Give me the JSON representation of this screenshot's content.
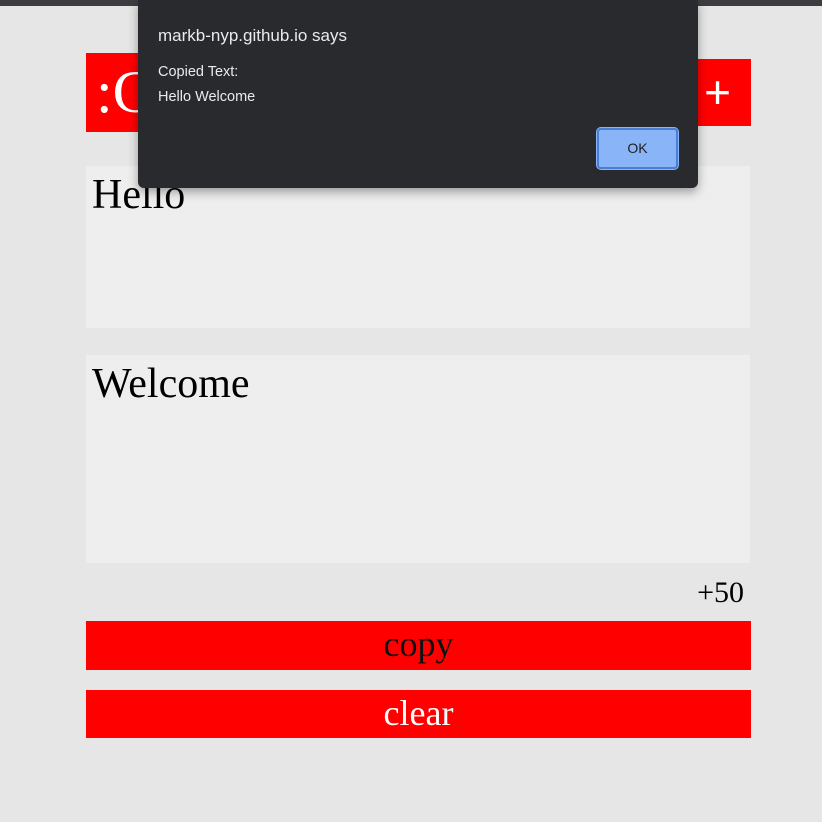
{
  "header": {
    "title_fragment": ":C",
    "add_label": "+"
  },
  "fields": [
    {
      "value": "Hello"
    },
    {
      "value": "Welcome"
    }
  ],
  "counter": "+50",
  "buttons": {
    "copy": "copy",
    "clear": "clear"
  },
  "dialog": {
    "title": "markb-nyp.github.io says",
    "message_line1": "Copied Text:",
    "message_line2": "Hello Welcome",
    "ok_label": "OK"
  },
  "colors": {
    "accent": "#ff0000",
    "background": "#e6e6e6",
    "field_bg": "#eeeeee",
    "dialog_bg": "#292a2d",
    "dialog_button": "#8ab4f8"
  }
}
